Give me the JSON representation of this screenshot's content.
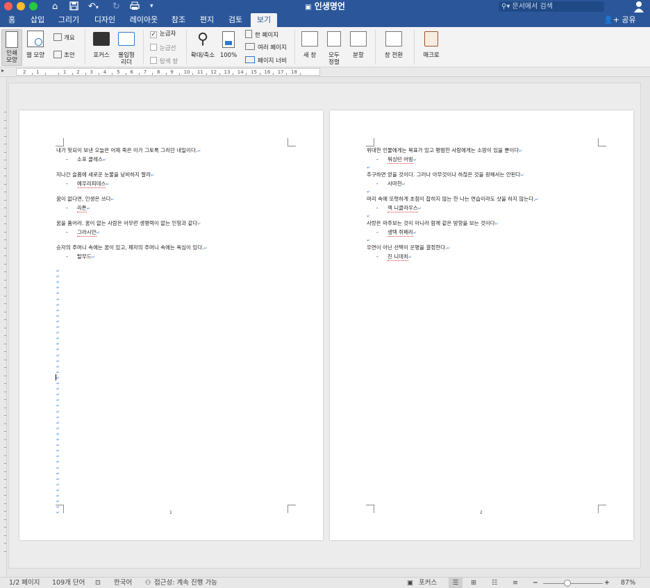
{
  "window": {
    "title": "인생명언",
    "search_placeholder": "문서에서 검색",
    "traffic_colors": [
      "#ff5f57",
      "#febc2e",
      "#28c840"
    ]
  },
  "tabs": [
    {
      "label": "홈"
    },
    {
      "label": "삽입"
    },
    {
      "label": "그리기"
    },
    {
      "label": "디자인"
    },
    {
      "label": "레이아웃"
    },
    {
      "label": "참조"
    },
    {
      "label": "편지"
    },
    {
      "label": "검토"
    },
    {
      "label": "보기",
      "active": true
    }
  ],
  "share_label": "공유",
  "ribbon": {
    "print_layout": [
      "인쇄",
      "모양"
    ],
    "web_layout": "웹 모양",
    "outline": "개요",
    "draft": "초안",
    "focus": "포커스",
    "immersive_reader": [
      "몰입형",
      "리더"
    ],
    "ruler": "눈금자",
    "gridlines": "눈금선",
    "nav_pane": "탐색 창",
    "zoom": "확대/축소",
    "zoom_100": "100%",
    "one_page": "한 페이지",
    "multiple_pages": "여러 페이지",
    "page_width": "페이지 너비",
    "new_window": "새 창",
    "arrange_all": [
      "모두",
      "정렬"
    ],
    "split": "분할",
    "switch_windows": "창 전환",
    "macros": "매크로"
  },
  "ruler_numbers": [
    "2",
    "1",
    "",
    "1",
    "2",
    "3",
    "4",
    "5",
    "6",
    "7",
    "8",
    "9",
    "10",
    "11",
    "12",
    "13",
    "14",
    "15",
    "16",
    "17",
    "18"
  ],
  "pages": [
    {
      "number": "1",
      "lines": [
        {
          "type": "quote",
          "text": "내가 헛되이 보낸 오늘은 어제 죽은 이가 그토록 그리던 내일이다."
        },
        {
          "type": "attr",
          "text": "소포 클레스"
        },
        {
          "type": "quote",
          "text": "지나간 슬픔에 새로운 눈물을 낭비하지 말라"
        },
        {
          "type": "attr",
          "text": "에우리피데스",
          "squiggle": true
        },
        {
          "type": "quote",
          "text": "꿈이 없다면, 인생은 쓰다"
        },
        {
          "type": "attr",
          "text": "리튼",
          "squiggle": true
        },
        {
          "type": "quote",
          "text": "꿈을 품어라. 꿈이 없는 사람은 아무런 생명력이 없는 인형과 같다"
        },
        {
          "type": "attr",
          "text": "그라시안",
          "squiggle": true
        },
        {
          "type": "quote",
          "text": "승자의 주머니 속에는 꿈이 있고, 패자의 주머니 속에는 욕심이 있다."
        },
        {
          "type": "attr",
          "text": "탈무드"
        }
      ]
    },
    {
      "number": "2",
      "lines": [
        {
          "type": "quote",
          "text": "위대한 인물에게는 목표가 있고 평범한 사람에게는 소망이 있을 뿐이다"
        },
        {
          "type": "attr",
          "text": "워싱턴 어빙",
          "squiggle": true
        },
        {
          "type": "blank"
        },
        {
          "type": "quote",
          "text": "추구하면 얻을 것이다. 그러나 아무것이나 하찮은 것을 원해서는 안된다"
        },
        {
          "type": "attr",
          "text": "사마천"
        },
        {
          "type": "blank"
        },
        {
          "type": "quote",
          "text": "머리 속에 또렷하게 초점이 잡히지 않는 한 나는 연습이라도 샷을 하지 않는다."
        },
        {
          "type": "attr",
          "text": "잭 니클라우스",
          "squiggle": true
        },
        {
          "type": "blank"
        },
        {
          "type": "quote",
          "text": "사랑은 마주보는 것이 아니라 함께 같은 방향을 보는 것이다"
        },
        {
          "type": "attr",
          "text": "생텍 쥐페리",
          "squiggle": true
        },
        {
          "type": "blank"
        },
        {
          "type": "quote",
          "text": "우연이 아닌 선택이 운명을 결정한다."
        },
        {
          "type": "attr",
          "text": "진 니데치",
          "squiggle": true
        }
      ]
    }
  ],
  "statusbar": {
    "page": "1/2 페이지",
    "words": "109개 단어",
    "language": "한국어",
    "accessibility": "접근성: 계속 진행 가능",
    "focus": "포커스",
    "zoom": "87%",
    "zoom_percent": 87
  },
  "colors": {
    "accent": "#2b579a",
    "para_mark": "#3a7fd0"
  }
}
